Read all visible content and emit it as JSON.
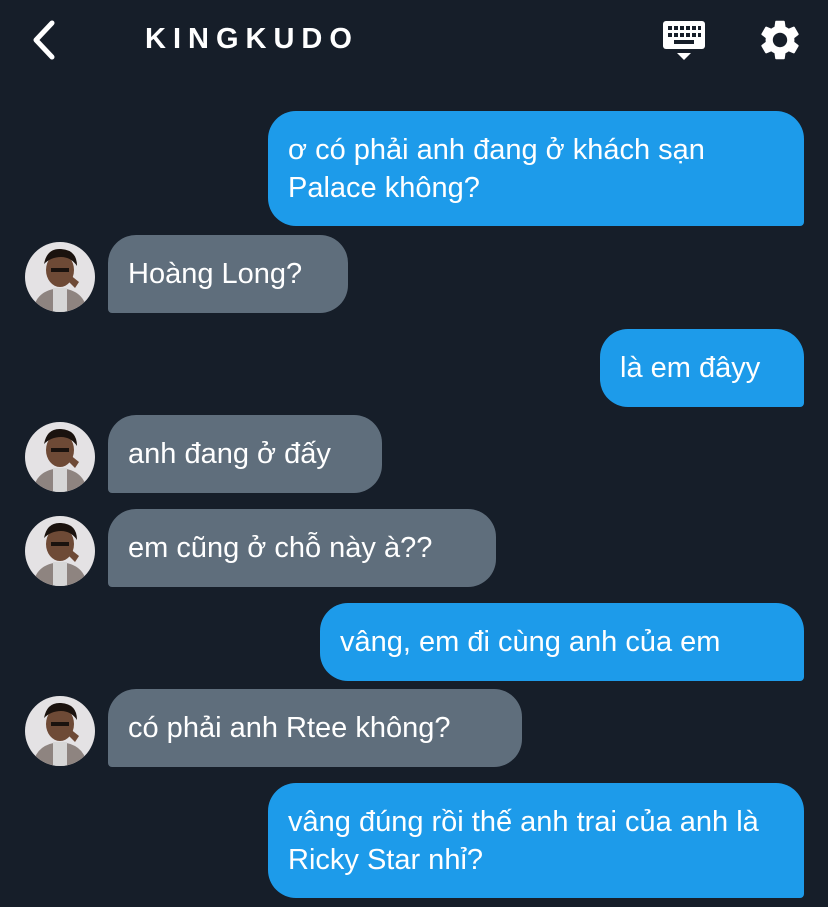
{
  "header": {
    "title": "KINGKUDO",
    "back_icon": "chevron-left-icon",
    "keyboard_icon": "keyboard-icon",
    "settings_icon": "gear-icon"
  },
  "colors": {
    "background": "#161e29",
    "outgoing_bubble": "#1d9bea",
    "incoming_bubble": "#5f6e7c",
    "text": "#ffffff"
  },
  "messages": [
    {
      "side": "out",
      "text": "ơ có phải anh đang ở khách sạn Palace không?"
    },
    {
      "side": "in",
      "text": "Hoàng Long?"
    },
    {
      "side": "out",
      "text": "là em đâyy"
    },
    {
      "side": "in",
      "text": "anh đang ở đấy"
    },
    {
      "side": "in",
      "text": "em cũng ở chỗ này à??"
    },
    {
      "side": "out",
      "text": "vâng, em đi cùng anh của em"
    },
    {
      "side": "in",
      "text": "có phải anh Rtee không?"
    },
    {
      "side": "out",
      "text": "vâng đúng rồi thế anh trai của anh là Ricky Star nhỉ?"
    }
  ]
}
